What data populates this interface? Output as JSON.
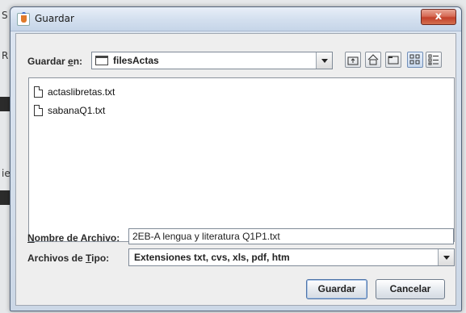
{
  "dialog": {
    "title": "Guardar",
    "close_label": "x"
  },
  "save_in": {
    "label_prefix": "Guardar ",
    "label_mnemonic": "e",
    "label_suffix": "n:",
    "folder": "filesActas"
  },
  "toolbar": {
    "icons": [
      "up-folder-icon",
      "home-icon",
      "new-folder-icon",
      "list-view-icon",
      "details-view-icon"
    ]
  },
  "files": [
    {
      "name": "actaslibretas.txt"
    },
    {
      "name": "sabanaQ1.txt"
    }
  ],
  "filename": {
    "label_mnemonic": "N",
    "label_suffix": "ombre de Archivo:",
    "value": "2EB-A lengua y literatura Q1P1.txt"
  },
  "filetype": {
    "label_prefix": "Archivos de ",
    "label_mnemonic": "T",
    "label_suffix": "ipo:",
    "value": "Extensiones txt, cvs, xls, pdf, htm"
  },
  "buttons": {
    "save": "Guardar",
    "cancel": "Cancelar"
  },
  "background": {
    "fragments": [
      "S",
      "R",
      "ie"
    ]
  }
}
